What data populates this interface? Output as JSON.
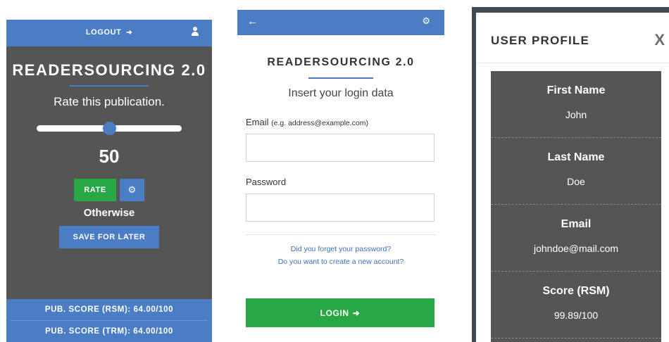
{
  "rate_panel": {
    "logout_label": "LOGOUT",
    "title": "READERSOURCING 2.0",
    "prompt": "Rate this publication.",
    "slider_value_fraction": 0.5,
    "value": "50",
    "rate_label": "RATE",
    "otherwise": "Otherwise",
    "save_later_label": "SAVE FOR LATER",
    "scores": [
      "PUB. SCORE (RSM): 64.00/100",
      "PUB. SCORE (TRM): 64.00/100"
    ]
  },
  "login_panel": {
    "title": "READERSOURCING 2.0",
    "subtitle": "Insert your login data",
    "email_label": "Email",
    "email_hint": "(e.g. address@example.com)",
    "email_value": "",
    "password_label": "Password",
    "password_value": "",
    "forgot_link": "Did you forget your password?",
    "create_link": "Do you want to create a new account?",
    "login_label": "LOGIN"
  },
  "profile_panel": {
    "title": "USER PROFILE",
    "close_label": "X",
    "fields": [
      {
        "label": "First Name",
        "value": "John"
      },
      {
        "label": "Last Name",
        "value": "Doe"
      },
      {
        "label": "Email",
        "value": "johndoe@mail.com"
      },
      {
        "label": "Score (RSM)",
        "value": "99.89/100"
      }
    ]
  },
  "colors": {
    "blue": "#4b7dc4",
    "green": "#28a745",
    "dark": "#555555",
    "link": "#3b6fb6"
  },
  "icons": [
    "sign-out-icon",
    "user-icon",
    "gear-icon",
    "arrow-left-icon",
    "sign-in-icon",
    "close-icon"
  ]
}
